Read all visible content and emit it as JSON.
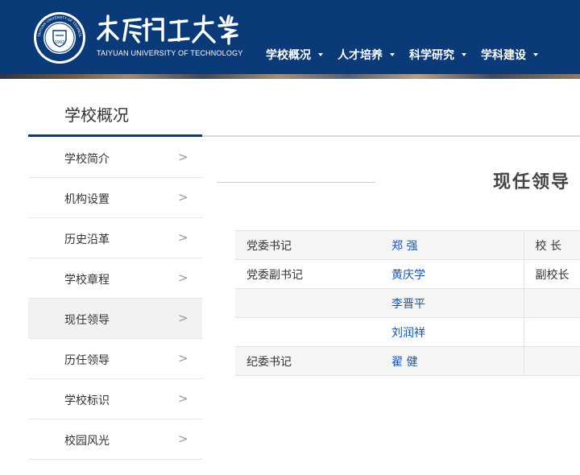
{
  "header": {
    "logo_year": "1902",
    "logo_ring_text": "TAIYUAN UNIVERSITY OF TECHNOLOGY",
    "logo_script_name": "太原理工大学",
    "logo_en": "TAIYUAN UNIVERSITY OF TECHNOLOGY",
    "nav": [
      {
        "label": "学校概况"
      },
      {
        "label": "人才培养"
      },
      {
        "label": "科学研究"
      },
      {
        "label": "学科建设"
      }
    ]
  },
  "sidebar": {
    "title": "学校概况",
    "arrow": ">",
    "items": [
      {
        "label": "学校简介"
      },
      {
        "label": "机构设置"
      },
      {
        "label": "历史沿革"
      },
      {
        "label": "学校章程"
      },
      {
        "label": "现任领导"
      },
      {
        "label": "历任领导"
      },
      {
        "label": "学校标识"
      },
      {
        "label": "校园风光"
      }
    ]
  },
  "content": {
    "title": "现任领导",
    "rows": [
      {
        "role": "党委书记",
        "name": "郑 强",
        "role2": "校 长"
      },
      {
        "role": "党委副书记",
        "name": "黄庆学",
        "role2": "副校长"
      },
      {
        "role": "",
        "name": "李晋平",
        "role2": ""
      },
      {
        "role": "",
        "name": "刘润祥",
        "role2": ""
      },
      {
        "role": "纪委书记",
        "name": "翟 健",
        "role2": ""
      }
    ]
  },
  "colors": {
    "header_bg": "#0a3a78",
    "accent": "#0a3a78",
    "link": "#1a56a8"
  }
}
